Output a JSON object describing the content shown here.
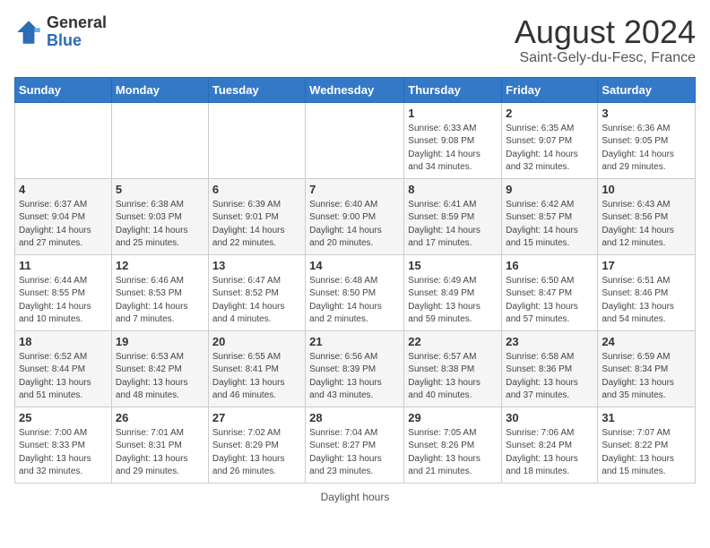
{
  "logo": {
    "general": "General",
    "blue": "Blue"
  },
  "header": {
    "title": "August 2024",
    "subtitle": "Saint-Gely-du-Fesc, France"
  },
  "weekdays": [
    "Sunday",
    "Monday",
    "Tuesday",
    "Wednesday",
    "Thursday",
    "Friday",
    "Saturday"
  ],
  "weeks": [
    [
      {
        "day": "",
        "info": ""
      },
      {
        "day": "",
        "info": ""
      },
      {
        "day": "",
        "info": ""
      },
      {
        "day": "",
        "info": ""
      },
      {
        "day": "1",
        "info": "Sunrise: 6:33 AM\nSunset: 9:08 PM\nDaylight: 14 hours\nand 34 minutes."
      },
      {
        "day": "2",
        "info": "Sunrise: 6:35 AM\nSunset: 9:07 PM\nDaylight: 14 hours\nand 32 minutes."
      },
      {
        "day": "3",
        "info": "Sunrise: 6:36 AM\nSunset: 9:05 PM\nDaylight: 14 hours\nand 29 minutes."
      }
    ],
    [
      {
        "day": "4",
        "info": "Sunrise: 6:37 AM\nSunset: 9:04 PM\nDaylight: 14 hours\nand 27 minutes."
      },
      {
        "day": "5",
        "info": "Sunrise: 6:38 AM\nSunset: 9:03 PM\nDaylight: 14 hours\nand 25 minutes."
      },
      {
        "day": "6",
        "info": "Sunrise: 6:39 AM\nSunset: 9:01 PM\nDaylight: 14 hours\nand 22 minutes."
      },
      {
        "day": "7",
        "info": "Sunrise: 6:40 AM\nSunset: 9:00 PM\nDaylight: 14 hours\nand 20 minutes."
      },
      {
        "day": "8",
        "info": "Sunrise: 6:41 AM\nSunset: 8:59 PM\nDaylight: 14 hours\nand 17 minutes."
      },
      {
        "day": "9",
        "info": "Sunrise: 6:42 AM\nSunset: 8:57 PM\nDaylight: 14 hours\nand 15 minutes."
      },
      {
        "day": "10",
        "info": "Sunrise: 6:43 AM\nSunset: 8:56 PM\nDaylight: 14 hours\nand 12 minutes."
      }
    ],
    [
      {
        "day": "11",
        "info": "Sunrise: 6:44 AM\nSunset: 8:55 PM\nDaylight: 14 hours\nand 10 minutes."
      },
      {
        "day": "12",
        "info": "Sunrise: 6:46 AM\nSunset: 8:53 PM\nDaylight: 14 hours\nand 7 minutes."
      },
      {
        "day": "13",
        "info": "Sunrise: 6:47 AM\nSunset: 8:52 PM\nDaylight: 14 hours\nand 4 minutes."
      },
      {
        "day": "14",
        "info": "Sunrise: 6:48 AM\nSunset: 8:50 PM\nDaylight: 14 hours\nand 2 minutes."
      },
      {
        "day": "15",
        "info": "Sunrise: 6:49 AM\nSunset: 8:49 PM\nDaylight: 13 hours\nand 59 minutes."
      },
      {
        "day": "16",
        "info": "Sunrise: 6:50 AM\nSunset: 8:47 PM\nDaylight: 13 hours\nand 57 minutes."
      },
      {
        "day": "17",
        "info": "Sunrise: 6:51 AM\nSunset: 8:46 PM\nDaylight: 13 hours\nand 54 minutes."
      }
    ],
    [
      {
        "day": "18",
        "info": "Sunrise: 6:52 AM\nSunset: 8:44 PM\nDaylight: 13 hours\nand 51 minutes."
      },
      {
        "day": "19",
        "info": "Sunrise: 6:53 AM\nSunset: 8:42 PM\nDaylight: 13 hours\nand 48 minutes."
      },
      {
        "day": "20",
        "info": "Sunrise: 6:55 AM\nSunset: 8:41 PM\nDaylight: 13 hours\nand 46 minutes."
      },
      {
        "day": "21",
        "info": "Sunrise: 6:56 AM\nSunset: 8:39 PM\nDaylight: 13 hours\nand 43 minutes."
      },
      {
        "day": "22",
        "info": "Sunrise: 6:57 AM\nSunset: 8:38 PM\nDaylight: 13 hours\nand 40 minutes."
      },
      {
        "day": "23",
        "info": "Sunrise: 6:58 AM\nSunset: 8:36 PM\nDaylight: 13 hours\nand 37 minutes."
      },
      {
        "day": "24",
        "info": "Sunrise: 6:59 AM\nSunset: 8:34 PM\nDaylight: 13 hours\nand 35 minutes."
      }
    ],
    [
      {
        "day": "25",
        "info": "Sunrise: 7:00 AM\nSunset: 8:33 PM\nDaylight: 13 hours\nand 32 minutes."
      },
      {
        "day": "26",
        "info": "Sunrise: 7:01 AM\nSunset: 8:31 PM\nDaylight: 13 hours\nand 29 minutes."
      },
      {
        "day": "27",
        "info": "Sunrise: 7:02 AM\nSunset: 8:29 PM\nDaylight: 13 hours\nand 26 minutes."
      },
      {
        "day": "28",
        "info": "Sunrise: 7:04 AM\nSunset: 8:27 PM\nDaylight: 13 hours\nand 23 minutes."
      },
      {
        "day": "29",
        "info": "Sunrise: 7:05 AM\nSunset: 8:26 PM\nDaylight: 13 hours\nand 21 minutes."
      },
      {
        "day": "30",
        "info": "Sunrise: 7:06 AM\nSunset: 8:24 PM\nDaylight: 13 hours\nand 18 minutes."
      },
      {
        "day": "31",
        "info": "Sunrise: 7:07 AM\nSunset: 8:22 PM\nDaylight: 13 hours\nand 15 minutes."
      }
    ]
  ],
  "footer": {
    "text": "Daylight hours"
  }
}
